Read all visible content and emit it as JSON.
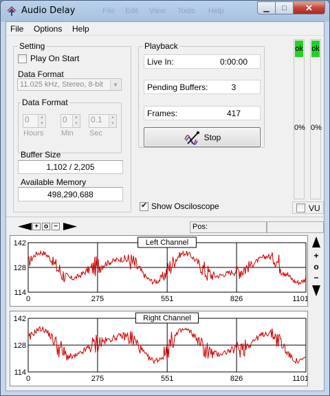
{
  "window": {
    "title": "Audio Delay",
    "ghost_menu": [
      "File",
      "Edit",
      "View",
      "Tools",
      "Help"
    ]
  },
  "menu": [
    "File",
    "Options",
    "Help"
  ],
  "setting": {
    "label": "Setting",
    "play_on_start": {
      "label": "Play On Start",
      "checked": false
    },
    "data_format_label": "Data Format",
    "data_format_value": "11.025 kHz, Stereo, 8-bit",
    "data_format2_label": "Data Format",
    "spinners": [
      {
        "value": "0",
        "unit": "Hours"
      },
      {
        "value": "0",
        "unit": "Min"
      },
      {
        "value": "0.1",
        "unit": "Sec"
      }
    ],
    "buffer_size_label": "Buffer Size",
    "buffer_size_value": "1,102 / 2,205",
    "available_memory_label": "Available Memory",
    "available_memory_value": "498,290,688"
  },
  "playback": {
    "label": "Playback",
    "live_in_label": "Live In:",
    "live_in_value": "0:00:00",
    "pending_label": "Pending Buffers:",
    "pending_value": "3",
    "frames_label": "Frames:",
    "frames_value": "417",
    "stop_label": "Stop"
  },
  "show_oscilloscope": {
    "label": "Show Osciloscope",
    "checked": true
  },
  "vu": {
    "left_status": "ok",
    "right_status": "ok",
    "left_pct": "0%",
    "right_pct": "0%",
    "label": "VU",
    "checked": false,
    "ok_color": "#22d322"
  },
  "scope_toolbar": {
    "pos_label": "Pos:"
  },
  "chart_data": [
    {
      "type": "line",
      "title": "Left Channel",
      "xlabel": "",
      "ylabel": "",
      "xlim": [
        0,
        1101
      ],
      "ylim": [
        114,
        142
      ],
      "xticks": [
        "0",
        "275",
        "551",
        "826",
        "1101"
      ],
      "yticks": [
        "142",
        "128",
        "114"
      ],
      "grid": true,
      "series": [
        {
          "color": "#cc0000",
          "shape": "wavy audio waveform oscillating around 128 with peaks near 138 and dips near 119"
        }
      ]
    },
    {
      "type": "line",
      "title": "Right Channel",
      "xlabel": "",
      "ylabel": "",
      "xlim": [
        0,
        1101
      ],
      "ylim": [
        114,
        142
      ],
      "xticks": [
        "0",
        "275",
        "551",
        "826",
        "1101"
      ],
      "yticks": [
        "142",
        "128",
        "114"
      ],
      "grid": true,
      "series": [
        {
          "color": "#cc0000",
          "shape": "wavy audio waveform oscillating around 128 with peaks near 139 and dips near 118"
        }
      ]
    }
  ]
}
